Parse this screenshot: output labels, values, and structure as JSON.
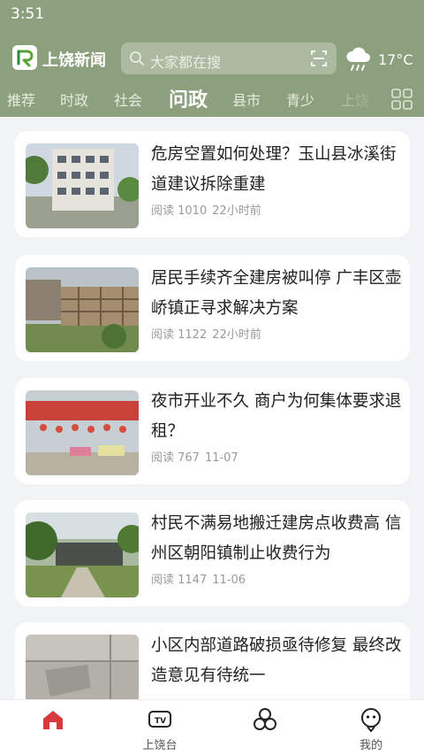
{
  "status": {
    "time": "3:51"
  },
  "header": {
    "app_title": "上饶新闻",
    "search_placeholder": "大家都在搜",
    "temperature": "17°C",
    "weather_icon": "cloud-rain-icon"
  },
  "tabs": [
    {
      "label": "推荐"
    },
    {
      "label": "时政"
    },
    {
      "label": "社会"
    },
    {
      "label": "问政",
      "active": true
    },
    {
      "label": "县市"
    },
    {
      "label": "青少"
    },
    {
      "label": "上饶"
    }
  ],
  "articles": [
    {
      "title": "危房空置如何处理？玉山县冰溪街道建议拆除重建",
      "reads": "阅读 1010",
      "time": "22小时前"
    },
    {
      "title": "居民手续齐全建房被叫停 广丰区壶峤镇正寻求解决方案",
      "reads": "阅读 1122",
      "time": "22小时前"
    },
    {
      "title": "夜市开业不久 商户为何集体要求退租？",
      "reads": "阅读 767",
      "time": "11-07"
    },
    {
      "title": "村民不满易地搬迁建房点收费高 信州区朝阳镇制止收费行为",
      "reads": "阅读 1147",
      "time": "11-06"
    },
    {
      "title": "小区内部道路破损亟待修复 最终改造意见有待统一",
      "reads": "",
      "time": ""
    }
  ],
  "bottom_nav": [
    {
      "label": "",
      "icon": "home-icon"
    },
    {
      "label": "上饶台",
      "icon": "tv-icon"
    },
    {
      "label": "",
      "icon": "circles-icon"
    },
    {
      "label": "我的",
      "icon": "profile-icon"
    }
  ],
  "colors": {
    "header_bg": "#8ca07d",
    "accent_red": "#d9393b"
  }
}
